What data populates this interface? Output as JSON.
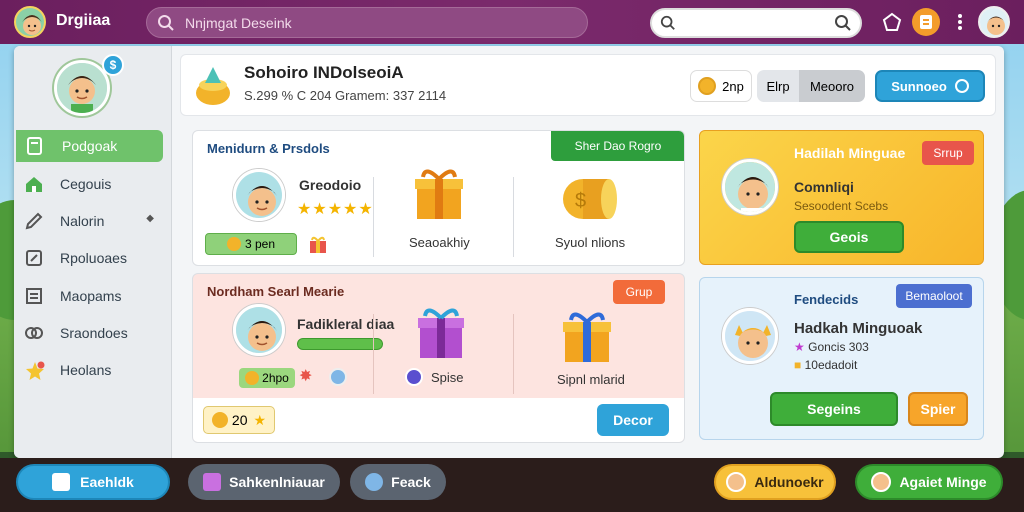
{
  "topbar": {
    "title": "Drgiiaa",
    "search_placeholder": "Nnjmgat Deseink",
    "search2_value": ""
  },
  "sidebar": {
    "badge": "$",
    "items": [
      {
        "label": "Podgoak",
        "icon": "document-icon",
        "active": true
      },
      {
        "label": "Cegouis",
        "icon": "home-icon"
      },
      {
        "label": "Nalorin",
        "icon": "pencil-icon"
      },
      {
        "label": "Rpoluoaes",
        "icon": "edit-icon"
      },
      {
        "label": "Maopams",
        "icon": "list-icon"
      },
      {
        "label": "Sraondoes",
        "icon": "people-icon"
      },
      {
        "label": "Heolans",
        "icon": "star-icon"
      }
    ]
  },
  "header": {
    "title": "Sohoiro INDolseoiA",
    "subtitle": "S.299 % C 204 Gramem: 337 2114",
    "coin_label": "2np",
    "toggle_left": "Elrp",
    "toggle_right": "Meooro",
    "action_button": "Sunnoeo"
  },
  "card1": {
    "title": "Menidurn & Prsdols",
    "tag": "Sher Dao Rogro",
    "player_name": "Greodoio",
    "stars": "★★★★★",
    "progress_label": "3 pen",
    "item1_label": "Seaoakhiy",
    "item2_label": "Syuol nlions"
  },
  "card2": {
    "title": "Nordham Searl Mearie",
    "tag": "Grup",
    "player_name": "Fadikleral diaa",
    "coin_label": "2hpo",
    "item1_label": "Spise",
    "item2_label": "Sipnl mlarid",
    "count": "20",
    "button": "Decor"
  },
  "card3": {
    "title": "Hadilah Minguae",
    "tag": "Srrup",
    "name": "Comnliqi",
    "sub": "Sesoodent Scebs",
    "button": "Geois"
  },
  "card4": {
    "title": "Fendecids",
    "tag": "Bemaoloot",
    "name": "Hadkah Minguoak",
    "line1": "Goncis 303",
    "line2": "10edadoit",
    "button_green": "Segeins",
    "button_orange": "Spier"
  },
  "bottom": {
    "btn1": "Eaehldk",
    "btn2": "Sahkenlniauar",
    "btn3": "Feack",
    "btn4": "Aldunoekr",
    "btn5": "Agaiet Minge"
  },
  "colors": {
    "topbar": "#6b1f5e",
    "accent_green": "#6fc26b",
    "accent_blue": "#2fa3d9",
    "accent_orange": "#f39c2b",
    "tag_red": "#e8554b"
  }
}
